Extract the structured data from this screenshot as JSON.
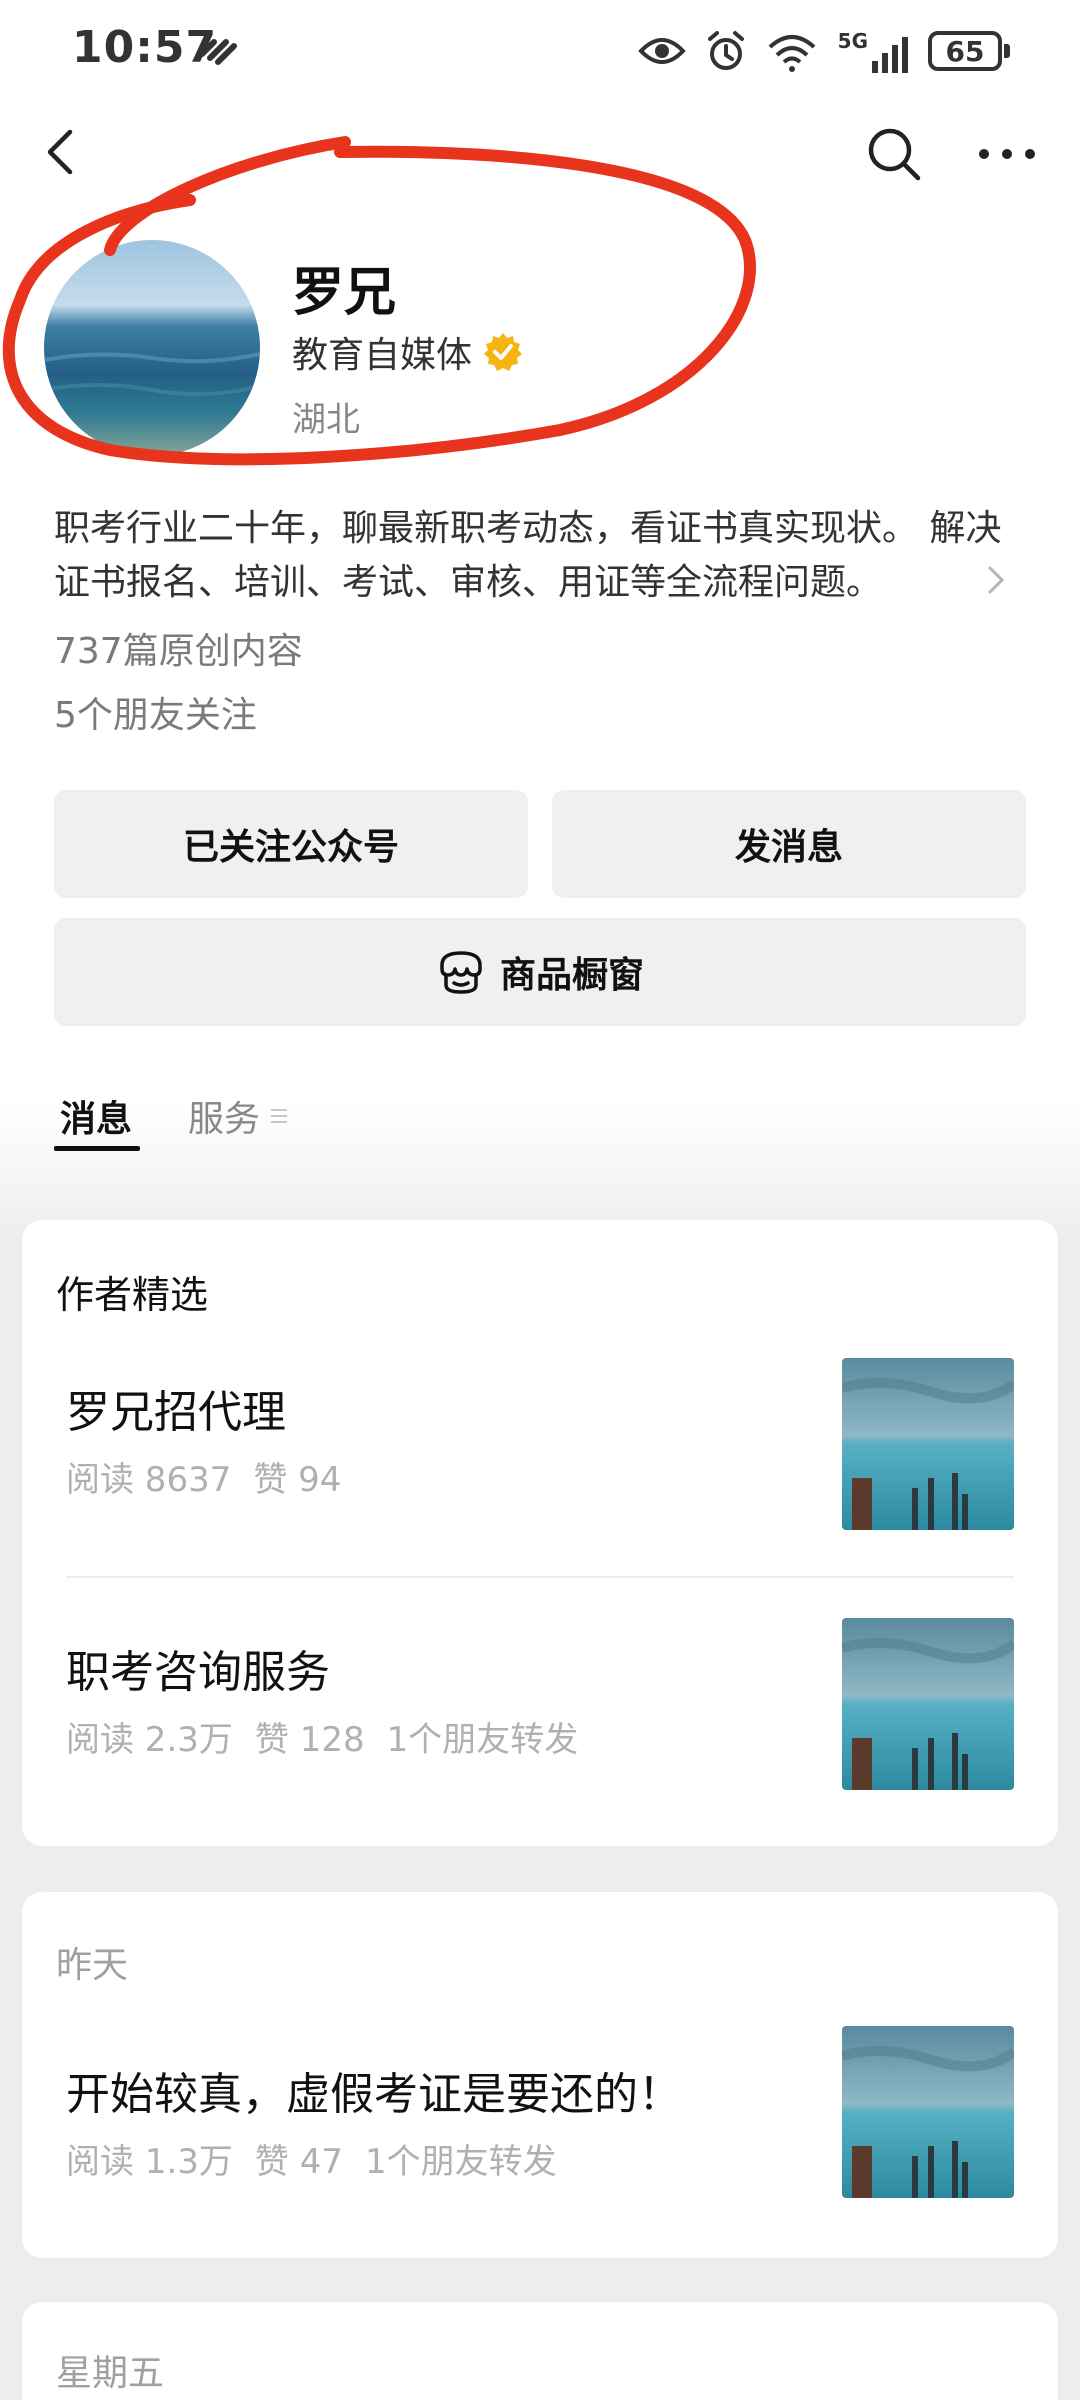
{
  "status_bar": {
    "time": "10:57",
    "network_label": "5G",
    "battery": "65"
  },
  "profile": {
    "name": "罗兄",
    "category": "教育自媒体",
    "location": "湖北",
    "description": "职考行业二十年，聊最新职考动态，看证书真实现状。 解决证书报名、培训、考试、审核、用证等全流程问题。",
    "articles_count": "737篇原创内容",
    "friends_following": "5个朋友关注"
  },
  "buttons": {
    "follow": "已关注公众号",
    "message": "发消息",
    "shop": "商品橱窗"
  },
  "tabs": {
    "messages": "消息",
    "services": "服务"
  },
  "featured": {
    "title": "作者精选",
    "articles": [
      {
        "title": "罗兄招代理",
        "reads": "阅读 8637",
        "likes": "赞 94",
        "forwards": ""
      },
      {
        "title": "职考咨询服务",
        "reads": "阅读 2.3万",
        "likes": "赞 128",
        "forwards": "1个朋友转发"
      }
    ]
  },
  "yesterday": {
    "date": "昨天",
    "articles": [
      {
        "title": "开始较真，虚假考证是要还的！",
        "reads": "阅读 1.3万",
        "likes": "赞 47",
        "forwards": "1个朋友转发"
      }
    ]
  },
  "friday": {
    "date": "星期五"
  },
  "colors": {
    "annotation": "#e8341c",
    "verified": "#f5b40f",
    "button_bg": "#f0f0f0",
    "page_bg": "#ededed"
  }
}
